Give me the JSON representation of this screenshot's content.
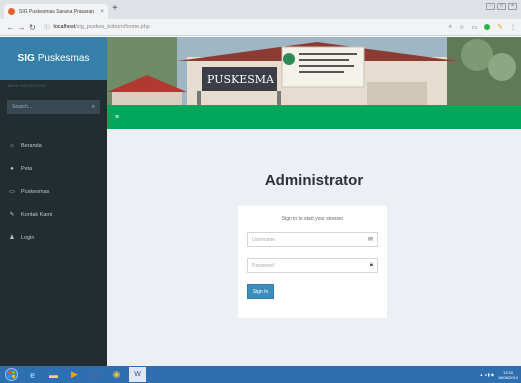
{
  "browser": {
    "tab_title": "SIG Puskesmas Sarana Prasaran",
    "tab_close": "×",
    "new_tab": "+",
    "url_host": "localhost",
    "url_path": "/sig_puskes_kobum/home.php",
    "window_controls": [
      "-",
      "□",
      "×"
    ]
  },
  "sidebar": {
    "brand_bold": "SIG",
    "brand_rest": "Puskesmas",
    "nav_header": "MAIN NAVIGATION",
    "search_placeholder": "Search...",
    "items": [
      {
        "label": "Beranda",
        "icon": "home-icon"
      },
      {
        "label": "Peta",
        "icon": "map-icon"
      },
      {
        "label": "Puskesmas",
        "icon": "building-icon"
      },
      {
        "label": "Kontak Kami",
        "icon": "contact-icon"
      },
      {
        "label": "Login",
        "icon": "users-icon"
      }
    ]
  },
  "banner": {
    "sign_text": "PUSKESMA"
  },
  "main": {
    "title": "Administrator",
    "login_msg": "Sign in to start your session",
    "username_placeholder": "Username",
    "password_placeholder": "Password",
    "signin_label": "Sign In"
  },
  "taskbar": {
    "time": "13:30",
    "date": "18/06/2019"
  },
  "colors": {
    "sidebar_bg": "#222d32",
    "brand_bg": "#367fa9",
    "greenbar": "#00a65a",
    "content_bg": "#ecf0f5",
    "button": "#3c8dbc",
    "taskbar": "#2e6fb2"
  }
}
